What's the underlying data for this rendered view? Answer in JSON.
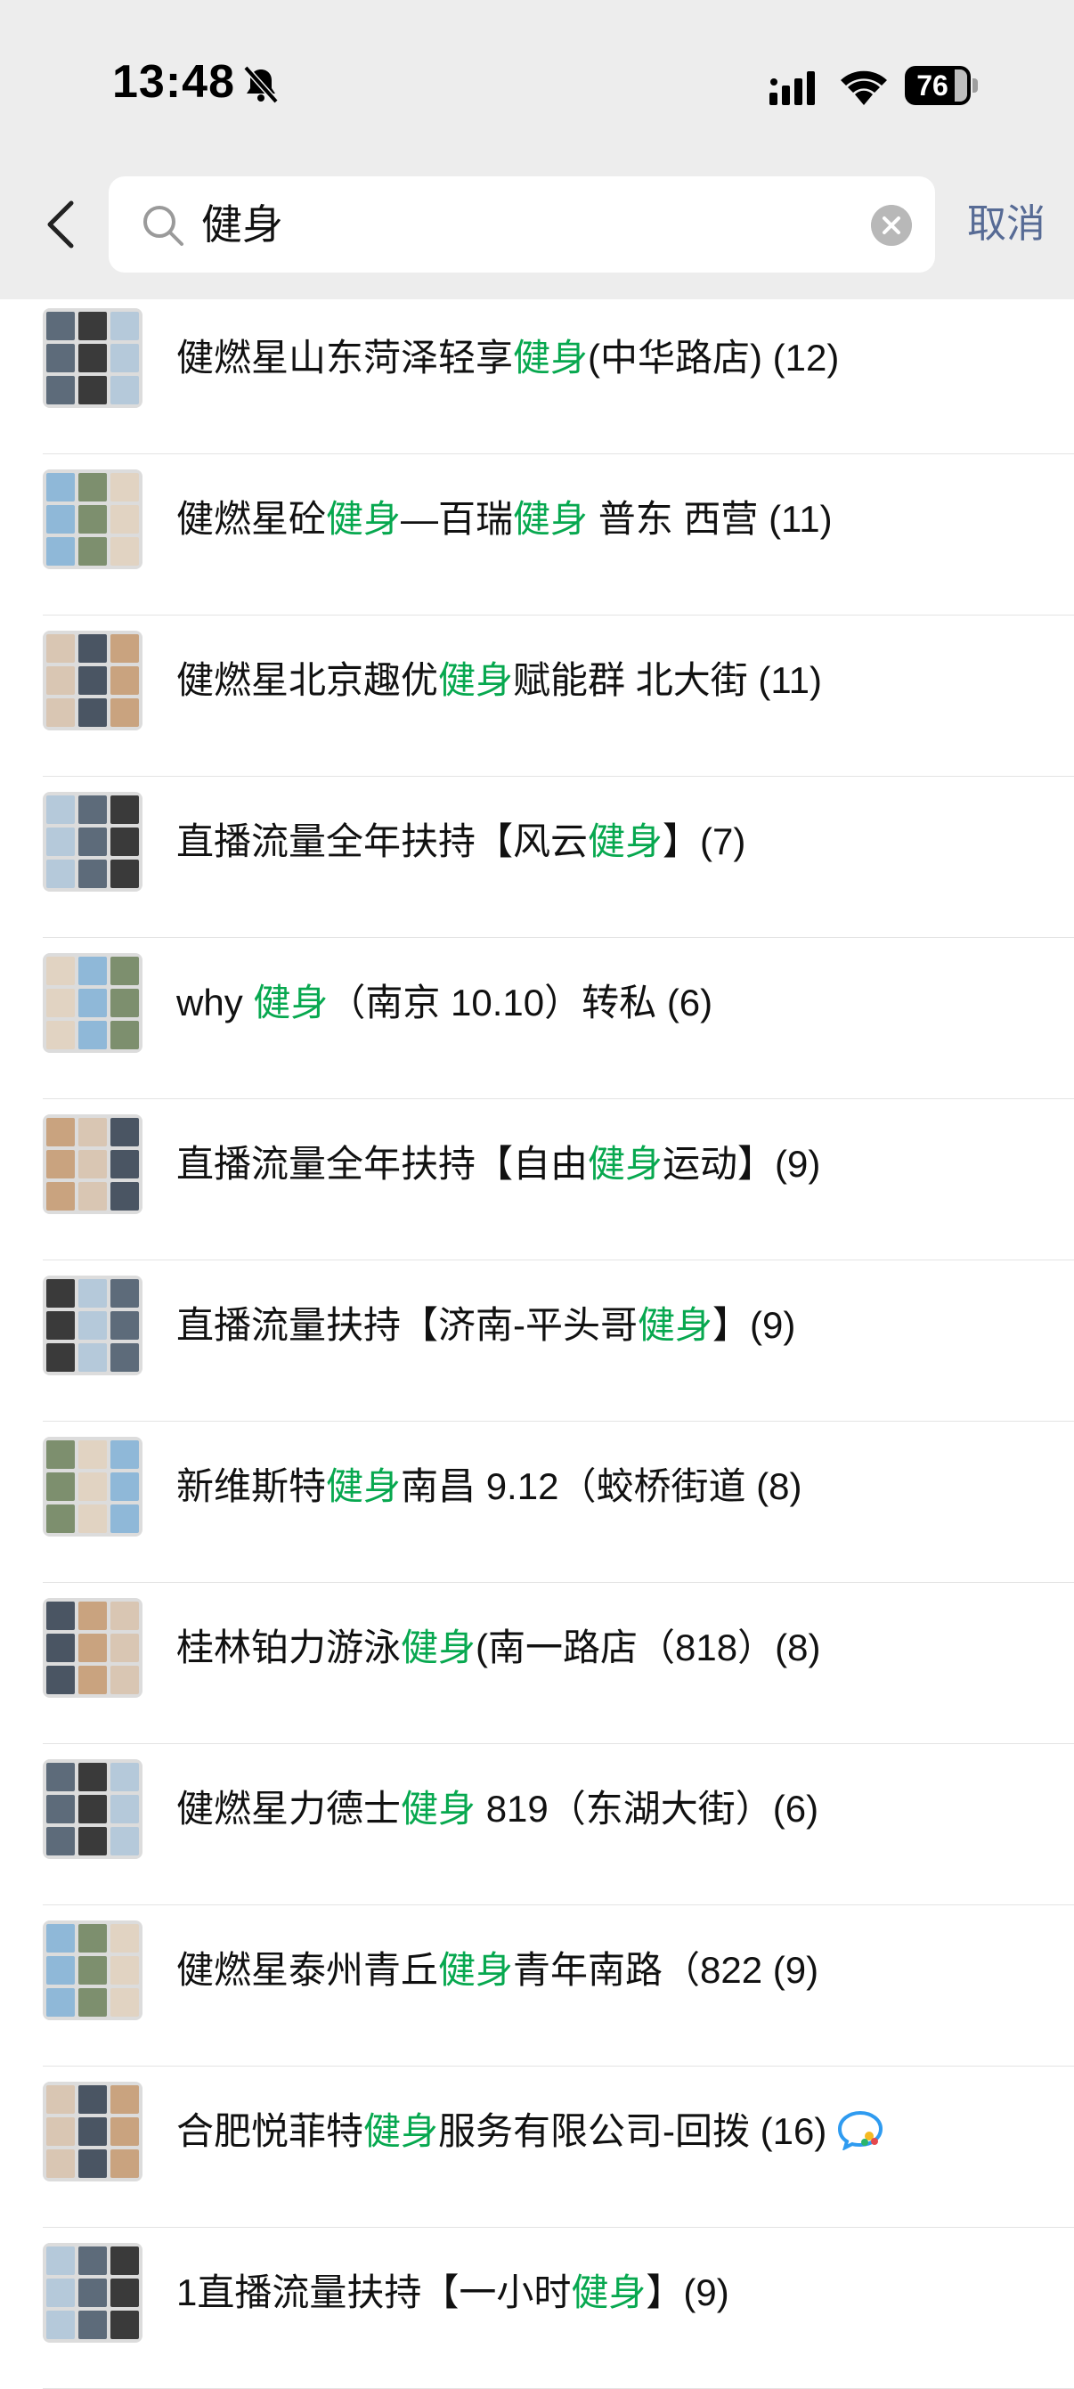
{
  "status_bar": {
    "time": "13:48",
    "battery_percent": "76",
    "icons": [
      "bell-off-icon",
      "signal-icon",
      "wifi-icon",
      "battery-icon"
    ]
  },
  "search": {
    "query": "健身",
    "cancel_label": "取消",
    "icons": [
      "back-icon",
      "search-icon",
      "clear-icon"
    ]
  },
  "colors": {
    "highlight": "#07a84f",
    "link": "#576b95",
    "header_bg": "#ededed"
  },
  "results": [
    {
      "parts": [
        {
          "t": "健燃星山东菏泽轻享"
        },
        {
          "t": "健身",
          "hl": true
        },
        {
          "t": "(中华路店) (12)"
        }
      ]
    },
    {
      "parts": [
        {
          "t": "健燃星砼"
        },
        {
          "t": "健身",
          "hl": true
        },
        {
          "t": "—百瑞"
        },
        {
          "t": "健身",
          "hl": true
        },
        {
          "t": " 普东 西营 (11)"
        }
      ]
    },
    {
      "parts": [
        {
          "t": "健燃星北京趣优"
        },
        {
          "t": "健身",
          "hl": true
        },
        {
          "t": "赋能群 北大街 (11)"
        }
      ]
    },
    {
      "parts": [
        {
          "t": "直播流量全年扶持【风云"
        },
        {
          "t": "健身",
          "hl": true
        },
        {
          "t": "】(7)"
        }
      ]
    },
    {
      "parts": [
        {
          "t": "why "
        },
        {
          "t": "健身",
          "hl": true
        },
        {
          "t": "（南京 10.10）转私 (6)"
        }
      ]
    },
    {
      "parts": [
        {
          "t": "直播流量全年扶持【自由"
        },
        {
          "t": "健身",
          "hl": true
        },
        {
          "t": "运动】(9)"
        }
      ]
    },
    {
      "parts": [
        {
          "t": "直播流量扶持【济南-平头哥"
        },
        {
          "t": "健身",
          "hl": true
        },
        {
          "t": "】(9)"
        }
      ]
    },
    {
      "parts": [
        {
          "t": "新维斯特"
        },
        {
          "t": "健身",
          "hl": true
        },
        {
          "t": "南昌 9.12（蛟桥街道 (8)"
        }
      ]
    },
    {
      "parts": [
        {
          "t": "桂林铂力游泳"
        },
        {
          "t": "健身",
          "hl": true
        },
        {
          "t": "(南一路店（818）(8)"
        }
      ]
    },
    {
      "parts": [
        {
          "t": "健燃星力德士"
        },
        {
          "t": "健身",
          "hl": true
        },
        {
          "t": " 819（东湖大街）(6)"
        }
      ]
    },
    {
      "parts": [
        {
          "t": "健燃星泰州青丘"
        },
        {
          "t": "健身",
          "hl": true
        },
        {
          "t": "青年南路（822 (9)"
        }
      ]
    },
    {
      "parts": [
        {
          "t": "合肥悦菲特"
        },
        {
          "t": "健身",
          "hl": true
        },
        {
          "t": "服务有限公司-回拨 (16)"
        }
      ],
      "badge": "chat-bubble-icon"
    },
    {
      "parts": [
        {
          "t": "1直播流量扶持【一小时"
        },
        {
          "t": "健身",
          "hl": true
        },
        {
          "t": "】(9)"
        }
      ]
    }
  ]
}
